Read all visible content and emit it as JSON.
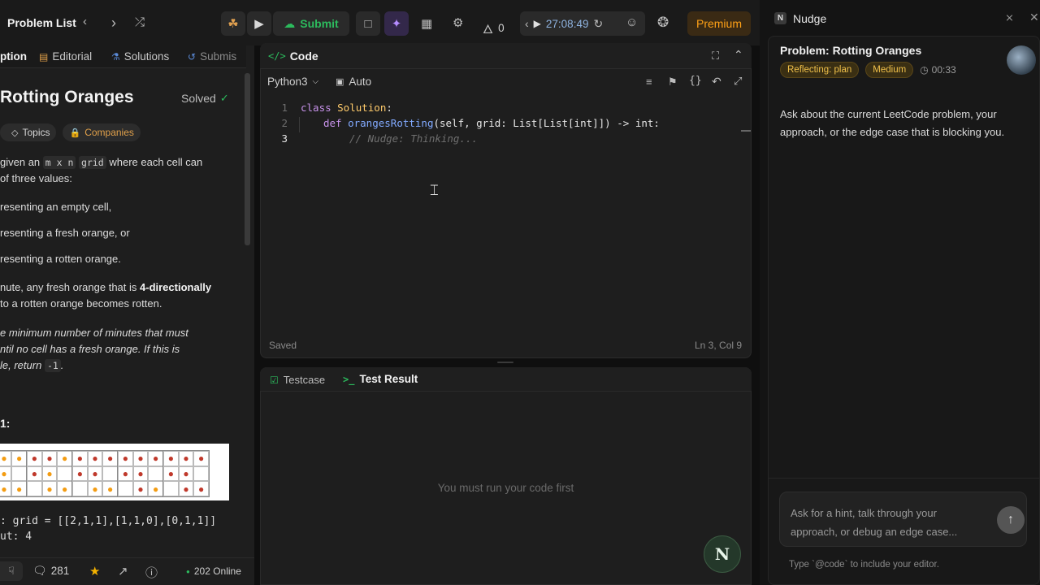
{
  "topbar": {
    "problem_list": "Problem List",
    "submit": "Submit",
    "streak": "0",
    "timer": "27:08:49",
    "premium": "Premium"
  },
  "left": {
    "tabs": [
      "ption",
      "Editorial",
      "Solutions",
      "Submis"
    ],
    "title": "Rotting Oranges",
    "solved": "Solved",
    "chips": [
      "Topics",
      "Companies"
    ],
    "desc_lines": {
      "l1a": "given an",
      "l1code1": "m x n",
      "l1code2": "grid",
      "l1b": "where each cell can",
      "l2": "of three values:",
      "l3": "resenting an empty cell,",
      "l4": "resenting a fresh orange, or",
      "l5": "resenting a rotten orange.",
      "l6a": "nute, any fresh orange that is",
      "l6b": "4-directionally",
      "l7": "to a rotten orange becomes rotten.",
      "l8": "e minimum number of minutes that must",
      "l9": "ntil no cell has a fresh orange. If this is",
      "l10a": "le, return",
      "l10code": "-1",
      "l10b": "."
    },
    "example_heading": "1:",
    "example_input": ": grid = [[2,1,1],[1,1,0],[0,1,1]]",
    "example_output": "ut: 4",
    "footer": {
      "comments": "281",
      "online": "202 Online"
    }
  },
  "editor": {
    "tab_label": "Code",
    "language": "Python3",
    "mode": "Auto",
    "lines": [
      {
        "n": "1",
        "kw": "class ",
        "name": "Solution",
        "rest": ":"
      },
      {
        "n": "2",
        "kw": "def ",
        "name": "orangesRotting",
        "rest": "(self, grid: List[List[int]]) -> int:"
      },
      {
        "n": "3",
        "comment": "// Nudge: Thinking..."
      }
    ],
    "status_left": "Saved",
    "status_right": "Ln 3, Col 9"
  },
  "test": {
    "tab1": "Testcase",
    "tab2": "Test Result",
    "empty": "You must run your code first",
    "fab": "N"
  },
  "nudge": {
    "title": "Nudge",
    "problem": "Problem: Rotting Oranges",
    "badge1": "Reflecting: plan",
    "badge2": "Medium",
    "elapsed": "00:33",
    "message_l1": "Ask about the current LeetCode problem, your",
    "message_l2": "approach, or the edge case that is blocking you.",
    "input_placeholder_l1": "Ask for a hint, talk through your",
    "input_placeholder_l2": "approach, or debug an edge case...",
    "hint": "Type `@code` to include your editor."
  },
  "colors": {
    "accent_green": "#2cbb5d",
    "premium": "#ffa116",
    "badge": "#f0c04a"
  }
}
